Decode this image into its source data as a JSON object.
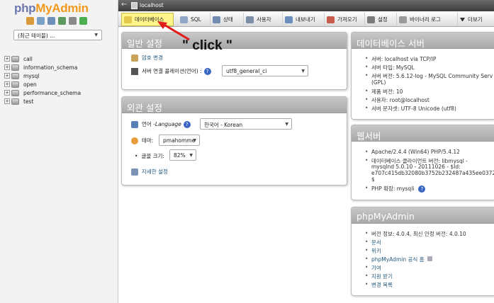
{
  "left": {
    "logo_part1": "php",
    "logo_part2": "MyAdmin",
    "recent_select": "(최근 테이블) ...",
    "databases": [
      "call",
      "information_schema",
      "mysql",
      "open",
      "performance_schema",
      "test"
    ]
  },
  "top": {
    "back": "←",
    "host": "localhost"
  },
  "tabs": [
    {
      "label": "데이터베이스",
      "icon": "database-icon"
    },
    {
      "label": "SQL",
      "icon": "sql-icon"
    },
    {
      "label": "상태",
      "icon": "status-icon"
    },
    {
      "label": "사용자",
      "icon": "users-icon"
    },
    {
      "label": "내보내기",
      "icon": "export-icon"
    },
    {
      "label": "가져오기",
      "icon": "import-icon"
    },
    {
      "label": "설정",
      "icon": "settings-icon"
    },
    {
      "label": "바이너리 로그",
      "icon": "binlog-icon"
    },
    {
      "label": "더보기",
      "icon": "more-icon"
    }
  ],
  "general": {
    "title": "일반 설정",
    "change_password": "암호 변경",
    "collation_label": "서버 연결 콜레이션(언어) :",
    "collation_value": "utf8_general_ci"
  },
  "appearance": {
    "title": "외관 설정",
    "language_label_a": "언어 - ",
    "language_label_b": "Language",
    "language_value": "한국어 - Korean",
    "theme_label": "테마:",
    "theme_value": "pmahomme",
    "fontsize_label": "글꼴 크기:",
    "fontsize_value": "82%",
    "more_settings": "자세한 설정"
  },
  "db_server": {
    "title": "데이터베이스 서버",
    "items": [
      "서버: localhost via TCP/IP",
      "서버 타입: MySQL",
      "서버 버전: 5.6.12-log - MySQL Community Serv",
      "(GPL)",
      "제품 버전: 10",
      "사용자: root@localhost",
      "서버 문자셋: UTF-8 Unicode (utf8)"
    ]
  },
  "web_server": {
    "title": "웹서버",
    "items": [
      "Apache/2.4.4 (Win64) PHP/5.4.12",
      "데이터베이스 클라이언트 버전: libmysql -",
      "mysqlnd 5.0.10 - 20111026 - $Id:",
      "e707c415db32080b3752b232487a435ee0372157",
      "$",
      "PHP 확장: mysqli"
    ]
  },
  "pma": {
    "title": "phpMyAdmin",
    "items": [
      "버전 정보: 4.0.4, 최신 안정 버전: 4.0.10",
      "문서",
      "위키",
      "phpMyAdmin 공식 홈",
      "기여",
      "지원 받기",
      "변경 목록"
    ]
  },
  "annotation": {
    "text": "\" click \""
  },
  "colors": {
    "active_tab": "#fff58a",
    "panel_header": "#b9b9b9",
    "arrow": "#e21b1b",
    "link": "#235a81"
  }
}
